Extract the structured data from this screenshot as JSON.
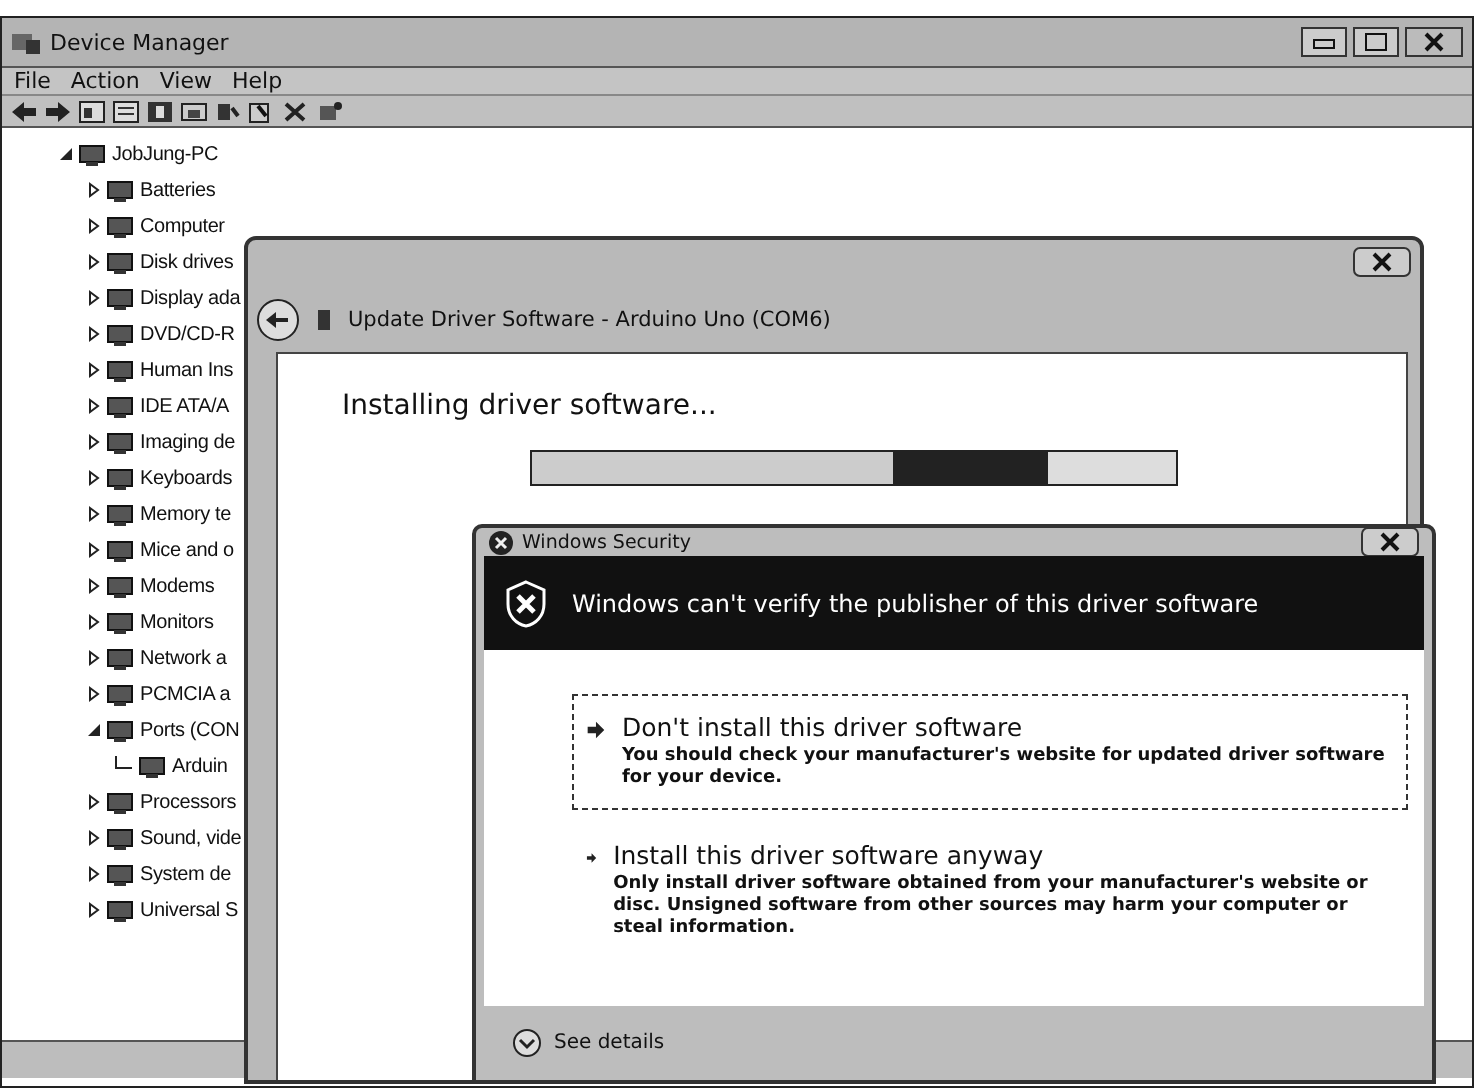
{
  "device_manager": {
    "title": "Device Manager",
    "menu": [
      "File",
      "Action",
      "View",
      "Help"
    ],
    "tree": [
      {
        "label": "JobJung-PC",
        "expanded": true,
        "children": [
          {
            "label": "Batteries",
            "expanded": false
          },
          {
            "label": "Computer",
            "expanded": false
          },
          {
            "label": "Disk drives",
            "expanded": false
          },
          {
            "label": "Display ada",
            "expanded": false
          },
          {
            "label": "DVD/CD-R",
            "expanded": false
          },
          {
            "label": "Human Ins",
            "expanded": false
          },
          {
            "label": "IDE ATA/A",
            "expanded": false
          },
          {
            "label": "Imaging de",
            "expanded": false
          },
          {
            "label": "Keyboards",
            "expanded": false
          },
          {
            "label": "Memory te",
            "expanded": false
          },
          {
            "label": "Mice and o",
            "expanded": false
          },
          {
            "label": "Modems",
            "expanded": false
          },
          {
            "label": "Monitors",
            "expanded": false
          },
          {
            "label": "Network a",
            "expanded": false
          },
          {
            "label": "PCMCIA a",
            "expanded": false
          },
          {
            "label": "Ports (CON",
            "expanded": true,
            "children": [
              {
                "label": "Arduin"
              }
            ]
          },
          {
            "label": "Processors",
            "expanded": false
          },
          {
            "label": "Sound, vide",
            "expanded": false
          },
          {
            "label": "System de",
            "expanded": false
          },
          {
            "label": "Universal S",
            "expanded": false
          }
        ]
      }
    ]
  },
  "update_driver": {
    "title": "Update Driver Software - Arduino Uno (COM6)",
    "heading": "Installing driver software...",
    "level": 0.8
  },
  "security": {
    "title": "Windows Security",
    "banner": "Windows can't verify the publisher of this driver software",
    "options": [
      {
        "title": "Don't install this driver software",
        "description": "You should check your manufacturer's website for updated driver software for your device.",
        "selected": true
      },
      {
        "title": "Install this driver software anyway",
        "description": "Only install driver software obtained from your manufacturer's website or disc. Unsigned software from other sources may harm your computer or steal information.",
        "selected": false
      }
    ],
    "details": "See details"
  }
}
